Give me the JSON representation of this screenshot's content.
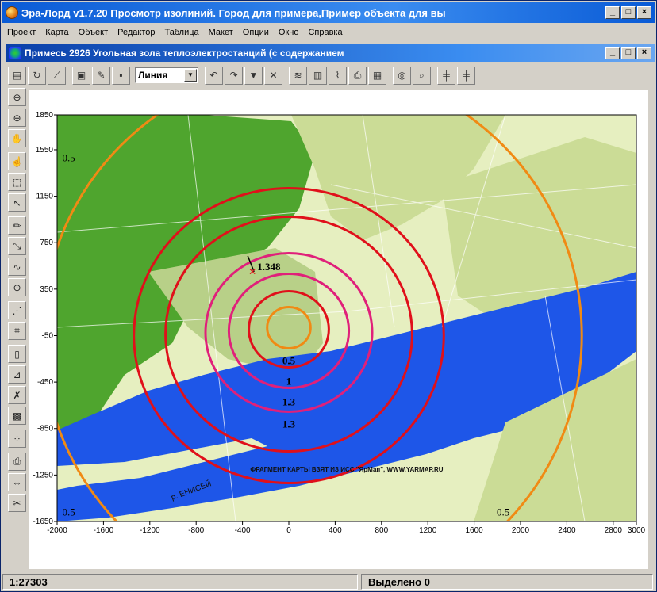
{
  "window": {
    "title": "Эра-Лорд v1.7.20  Просмотр изолиний. Город для примера,Пример объекта для вы",
    "controls": [
      "_",
      "□",
      "×"
    ]
  },
  "menu": [
    "Проект",
    "Карта",
    "Объект",
    "Редактор",
    "Таблица",
    "Макет",
    "Опции",
    "Окно",
    "Справка"
  ],
  "child_window": {
    "title": "Примесь 2926 Угольная зола теплоэлектростанций (с содержанием",
    "controls": [
      "_",
      "□",
      "×"
    ]
  },
  "toolbar": {
    "line_type": "Линия"
  },
  "map": {
    "attribution": "ФРАГМЕНТ КАРТЫ ВЗЯТ ИЗ ИСС \"ЯрМап\", WWW.YARMAP.RU",
    "river_label": "р. ЕНИСЕЙ",
    "colors": {
      "water": "#1e56e8",
      "land": "#e6efc0",
      "park": "#4fa52e",
      "residential": "#c9d89a",
      "iso_red": "#e0101a",
      "iso_magenta": "#e0207a",
      "iso_orange": "#f08a14"
    }
  },
  "chart_data": {
    "type": "contour",
    "x_ticks": [
      "-2000",
      "-1600",
      "-1200",
      "-800",
      "-400",
      "0",
      "400",
      "800",
      "1200",
      "1600",
      "2000",
      "2400",
      "2800",
      "3000"
    ],
    "y_ticks": [
      "1850",
      "1550",
      "1150",
      "750",
      "350",
      "-50",
      "-450",
      "-850",
      "-1250",
      "-1650"
    ],
    "xlim": [
      -2000,
      3000
    ],
    "ylim": [
      -1650,
      1850
    ],
    "isolines": [
      {
        "label": "0.5",
        "color": "orange"
      },
      {
        "label": "1",
        "color": "red"
      },
      {
        "label": "1.3",
        "color": "magenta"
      },
      {
        "label": "1.3",
        "color": "magenta"
      },
      {
        "label": "0.5",
        "color": "orange"
      },
      {
        "label": "0.5",
        "color": "orange"
      },
      {
        "label": "0.5",
        "color": "orange"
      }
    ],
    "max_marker": {
      "label": "1.348",
      "x": -300,
      "y": 500
    }
  },
  "status": {
    "scale": "1:27303",
    "selected": "Выделено 0"
  }
}
